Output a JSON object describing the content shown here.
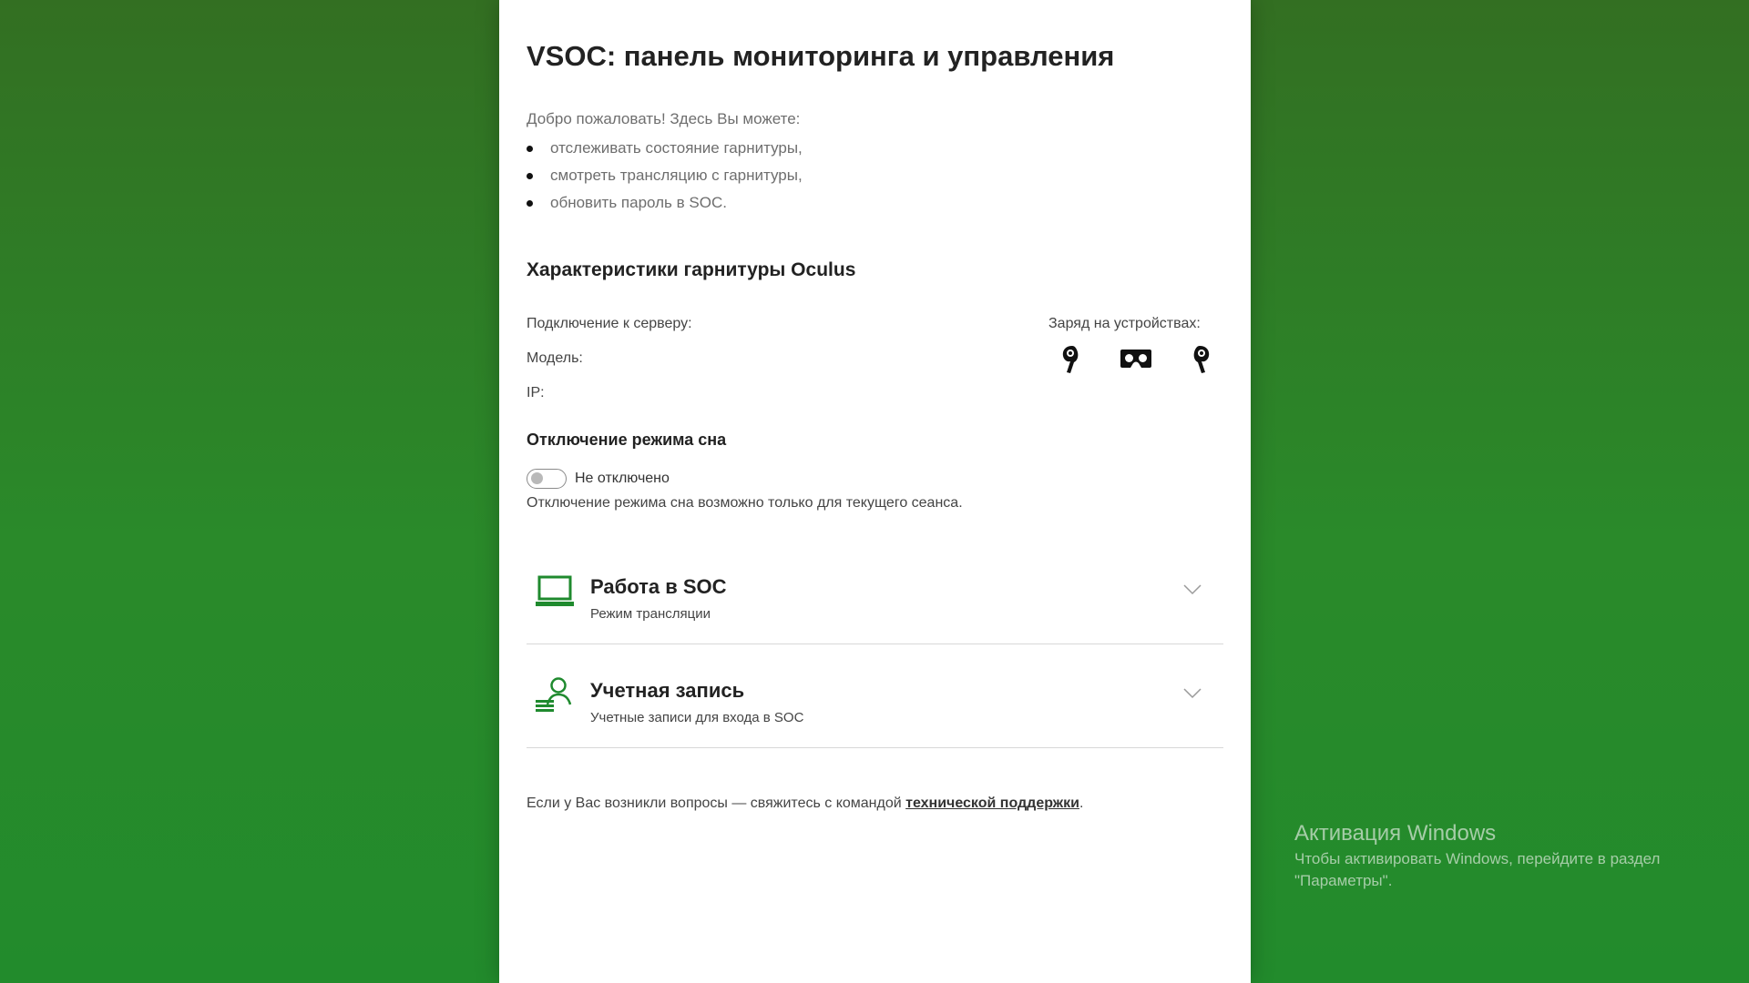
{
  "header": {
    "title": "VSOC: панель мониторинга и управления"
  },
  "intro": {
    "greeting": "Добро пожаловать! Здесь Вы можете:",
    "items": [
      "отслеживать состояние гарнитуры,",
      "смотреть трансляцию с гарнитуры,",
      "обновить пароль в SOC."
    ]
  },
  "headset": {
    "section_title": "Характеристики гарнитуры Oculus",
    "connection_label": "Подключение к серверу:",
    "model_label": "Модель:",
    "ip_label": "IP:",
    "battery_label": "Заряд на устройствах:",
    "battery_devices": [
      "left-controller-icon",
      "headset-icon",
      "right-controller-icon"
    ]
  },
  "sleep": {
    "title": "Отключение режима сна",
    "toggle_label": "Не отключено",
    "toggle_on": false,
    "note": "Отключение режима сна возможно только для текущего сеанса."
  },
  "accordions": [
    {
      "icon": "laptop-icon",
      "title": "Работа в SOC",
      "subtitle": "Режим трансляции"
    },
    {
      "icon": "user-account-icon",
      "title": "Учетная запись",
      "subtitle": "Учетные записи для входа в SOC"
    }
  ],
  "footer": {
    "text_before": "Если у Вас возникли вопросы — свяжитесь с командой ",
    "link_text": "технической поддержки",
    "text_after": "."
  },
  "watermark": {
    "title": "Активация Windows",
    "text": "Чтобы активировать Windows, перейдите в раздел \"Параметры\"."
  },
  "colors": {
    "accent_green": "#1f8a2e",
    "background_top": "#336f22",
    "background_bottom": "#228b2c"
  }
}
